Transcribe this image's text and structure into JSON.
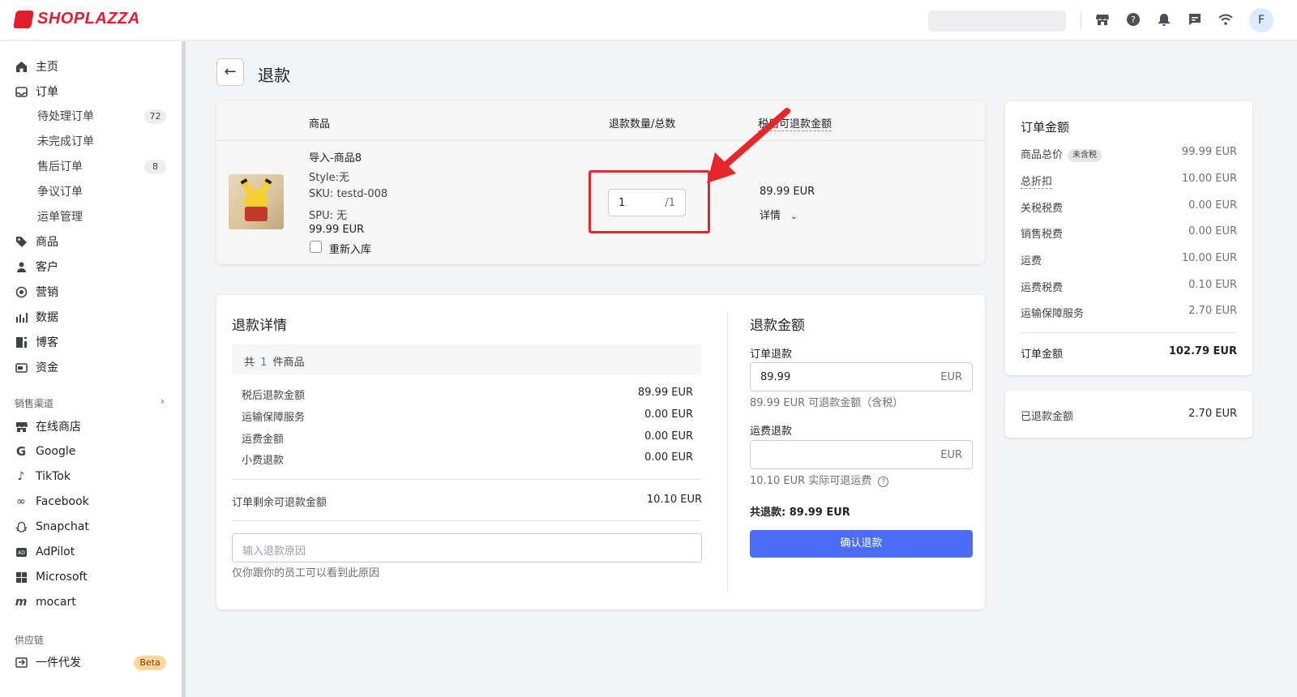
{
  "brand": {
    "name": "SHOPLAZZA",
    "color": "#e11d2e"
  },
  "topbar": {
    "icons": [
      "store-icon",
      "help-icon",
      "bell-icon",
      "chat-icon",
      "wifi-icon"
    ],
    "avatar_initial": "F"
  },
  "sidebar": {
    "items": [
      {
        "label": "主页",
        "icon": "home-icon"
      },
      {
        "label": "订单",
        "icon": "order-icon"
      }
    ],
    "order_sub": [
      {
        "label": "待处理订单",
        "count": "72"
      },
      {
        "label": "未完成订单",
        "count": ""
      },
      {
        "label": "售后订单",
        "count": "8"
      },
      {
        "label": "争议订单",
        "count": ""
      },
      {
        "label": "运单管理",
        "count": ""
      }
    ],
    "main_items": [
      {
        "label": "商品",
        "icon": "tag-icon"
      },
      {
        "label": "客户",
        "icon": "person-icon"
      },
      {
        "label": "营销",
        "icon": "marketing-icon"
      },
      {
        "label": "数据",
        "icon": "chart-icon"
      },
      {
        "label": "博客",
        "icon": "blog-icon"
      },
      {
        "label": "资金",
        "icon": "wallet-icon"
      }
    ],
    "sales_channel_title": "销售渠道",
    "channels": [
      {
        "label": "在线商店",
        "icon": "store-icon"
      },
      {
        "label": "Google",
        "icon": "google-icon"
      },
      {
        "label": "TikTok",
        "icon": "tiktok-icon"
      },
      {
        "label": "Facebook",
        "icon": "meta-icon"
      },
      {
        "label": "Snapchat",
        "icon": "snapchat-icon"
      },
      {
        "label": "AdPilot",
        "icon": "adpilot-icon"
      },
      {
        "label": "Microsoft",
        "icon": "microsoft-icon"
      },
      {
        "label": "mocart",
        "icon": "mocart-icon"
      }
    ],
    "supply_title": "供应链",
    "supply_item": {
      "label": "一件代发",
      "badge": "Beta"
    }
  },
  "page": {
    "title": "退款"
  },
  "product_table": {
    "headers": {
      "product": "商品",
      "qty": "退款数量/总数",
      "amount": "税后可退款金额"
    },
    "product": {
      "name": "导入-商品8",
      "style": "Style:无",
      "sku": "SKU: testd-008",
      "spu": "SPU: 无",
      "price": "99.99 EUR",
      "restock_label": "重新入库"
    },
    "qty": {
      "value": "1",
      "total": "/1"
    },
    "amount": {
      "value": "89.99 EUR",
      "detail_label": "详情"
    }
  },
  "refund_detail": {
    "title": "退款详情",
    "count_prefix": "共",
    "count": "1",
    "count_suffix": "件商品",
    "rows": [
      {
        "label": "税后退款金额",
        "value": "89.99 EUR"
      },
      {
        "label": "运输保障服务",
        "value": "0.00 EUR"
      },
      {
        "label": "运费金额",
        "value": "0.00 EUR"
      },
      {
        "label": "小费退款",
        "value": "0.00 EUR"
      }
    ],
    "remaining_label": "订单剩余可退款金额",
    "remaining_value": "10.10 EUR",
    "reason_placeholder": "输入退款原因",
    "reason_hint": "仅你跟你的员工可以看到此原因"
  },
  "refund_amount": {
    "title": "退款金额",
    "order_refund_label": "订单退款",
    "order_refund_value": "89.99",
    "currency": "EUR",
    "order_refund_hint": "89.99 EUR 可退款金额（含税）",
    "shipping_refund_label": "运费退款",
    "shipping_refund_hint": "10.10 EUR 实际可退运费",
    "total": "共退款: 89.99 EUR",
    "confirm_label": "确认退款"
  },
  "order_summary": {
    "title": "订单金额",
    "rows": [
      {
        "label": "商品总价",
        "tag": "未含税",
        "value": "99.99 EUR"
      },
      {
        "label": "总折扣",
        "tag": "",
        "value": "10.00 EUR"
      },
      {
        "label": "关税税费",
        "tag": "",
        "value": "0.00 EUR"
      },
      {
        "label": "销售税费",
        "tag": "",
        "value": "0.00 EUR"
      },
      {
        "label": "运费",
        "tag": "",
        "value": "10.00 EUR"
      },
      {
        "label": "运费税费",
        "tag": "",
        "value": "0.10 EUR"
      },
      {
        "label": "运输保障服务",
        "tag": "",
        "value": "2.70 EUR"
      }
    ],
    "total_label": "订单金额",
    "total_value": "102.79 EUR"
  },
  "refunded": {
    "label": "已退款金额",
    "value": "2.70 EUR"
  },
  "colors": {
    "primary": "#4a6cf7",
    "highlight": "#e5262b"
  }
}
